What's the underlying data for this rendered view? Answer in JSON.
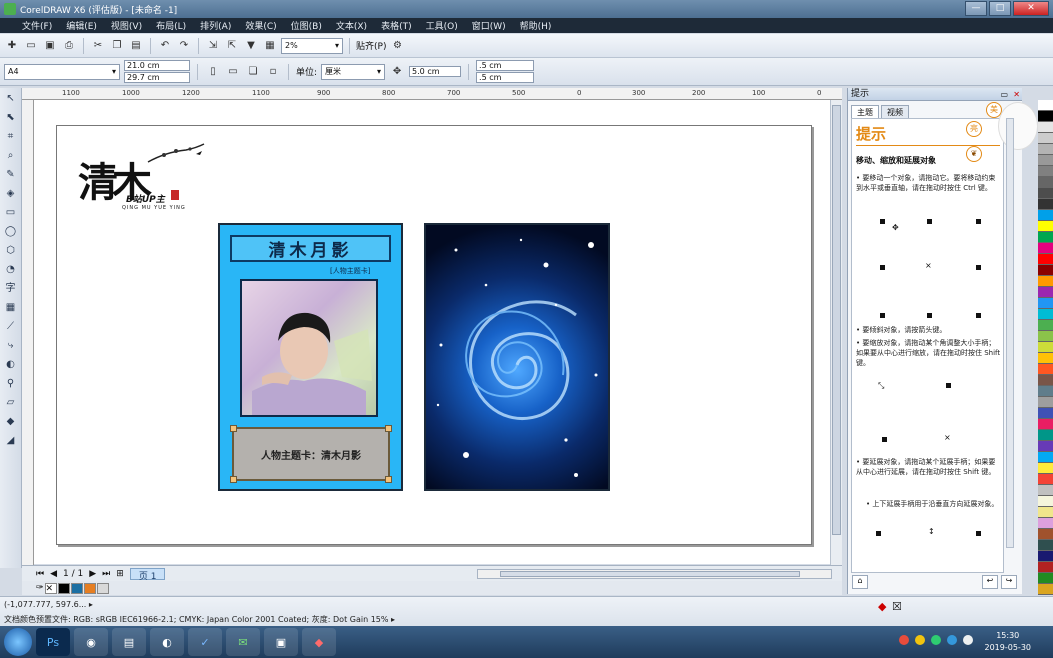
{
  "window": {
    "title": "CorelDRAW X6 (评估版) - [未命名 -1]",
    "buttons": [
      "—",
      "□",
      "✕"
    ]
  },
  "menu": [
    "文件(F)",
    "编辑(E)",
    "视图(V)",
    "布局(L)",
    "排列(A)",
    "效果(C)",
    "位图(B)",
    "文本(X)",
    "表格(T)",
    "工具(O)",
    "窗口(W)",
    "帮助(H)"
  ],
  "toolbar": {
    "zoom": "2%",
    "snap": "贴齐(P)"
  },
  "propbar": {
    "page_size": "A4",
    "width": "21.0 cm",
    "height": "29.7 cm",
    "unit_label": "单位:",
    "unit_value": "厘米",
    "nudge": "5.0 cm",
    "dup_x": ".5 cm",
    "dup_y": ".5 cm"
  },
  "ruler": {
    "ticks": [
      "1100",
      "1000",
      "1200",
      "1100",
      "900",
      "800",
      "700",
      "500",
      "0",
      "300",
      "200",
      "100",
      "0"
    ]
  },
  "logo": {
    "main": "清木",
    "sub": "B站UP主",
    "romanized": "QING MU YUE YING"
  },
  "card1": {
    "title": "清木月影",
    "subtitle": "[人物主题卡]",
    "caption": "人物主题卡：清木月影"
  },
  "bottombar": {
    "page_count": "1 / 1",
    "page_tab": "页 1"
  },
  "status": {
    "coords": "(-1,077.777, 597.6... ▸",
    "color_profile": "文档颜色预置文件: RGB: sRGB IEC61966-2.1; CMYK: Japan Color 2001 Coated; 灰度: Dot Gain 15% ▸"
  },
  "docker": {
    "header": "提示",
    "tabs": [
      "主题",
      "视频"
    ],
    "title": "提示",
    "subtitle": "移动、缩放和延展对象",
    "b1": "• 要移动一个对象，请拖动它。要将移动约束到水平或垂直轴，请在拖动时按住 Ctrl 键。",
    "b2": "• 要倾斜对象，请按箭头键。",
    "b3": "• 要缩放对象，请拖动某个角调整大小手柄；如果要从中心进行缩放，请在拖动时按住 Shift 键。",
    "b4": "• 要延展对象，请拖动某个延展手柄；如果要从中心进行延展，请在拖动时按住 Shift 键。",
    "b5": "• 上下延展手柄用于沿垂直方向延展对象。"
  },
  "palette": [
    "#ffffff",
    "#000000",
    "#e5e5e5",
    "#cccccc",
    "#b3b3b3",
    "#999999",
    "#808080",
    "#666666",
    "#4d4d4d",
    "#333333",
    "#00a0e9",
    "#ffff00",
    "#00a650",
    "#e4007f",
    "#ff0000",
    "#8b0000",
    "#ff9900",
    "#9c27b0",
    "#2196f3",
    "#00bcd4",
    "#4caf50",
    "#8bc34a",
    "#cddc39",
    "#ffc107",
    "#ff5722",
    "#795548",
    "#607d8b",
    "#9e9e9e",
    "#3f51b5",
    "#e91e63",
    "#009688",
    "#673ab7",
    "#03a9f4",
    "#ffeb3b",
    "#f44336",
    "#c0c0c0",
    "#f5f5dc",
    "#f0e68c",
    "#dda0dd",
    "#a0522d",
    "#2f4f4f",
    "#191970",
    "#b22222",
    "#228b22",
    "#daa520"
  ],
  "taskbar": {
    "time": "15:30",
    "date": "2019-05-30"
  }
}
